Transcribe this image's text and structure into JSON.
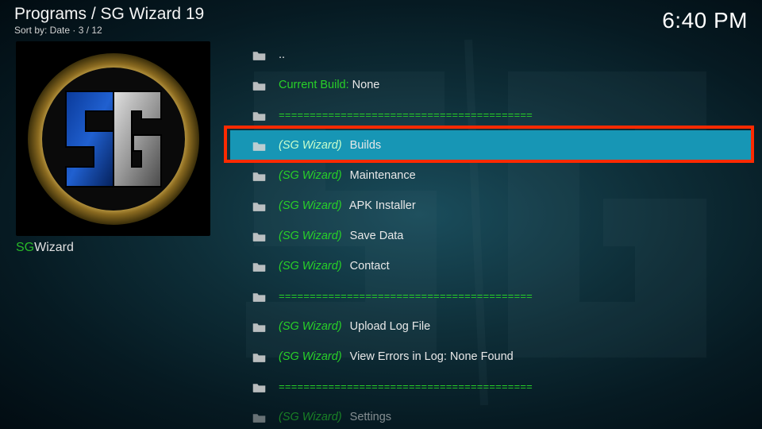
{
  "header": {
    "breadcrumb": "Programs / SG Wizard 19",
    "sortline": "Sort by: Date  ·  3 / 12",
    "clock": "6:40 PM"
  },
  "side": {
    "plugin_sg": "SG",
    "plugin_wizard": "Wizard"
  },
  "list": {
    "items": [
      {
        "type": "updir",
        "label": ".."
      },
      {
        "type": "status",
        "greenLabel": "Current Build:",
        "plain": "  None"
      },
      {
        "type": "separator",
        "sep": "========================================="
      },
      {
        "type": "entry",
        "prefix": "(SG Wizard)",
        "label": "  Builds",
        "selected": true,
        "highlighted": true
      },
      {
        "type": "entry",
        "prefix": "(SG Wizard)",
        "label": "  Maintenance"
      },
      {
        "type": "entry",
        "prefix": "(SG Wizard)",
        "label": "  APK Installer"
      },
      {
        "type": "entry",
        "prefix": "(SG Wizard)",
        "label": "  Save Data"
      },
      {
        "type": "entry",
        "prefix": "(SG Wizard)",
        "label": "  Contact"
      },
      {
        "type": "separator",
        "sep": "========================================="
      },
      {
        "type": "entry",
        "prefix": "(SG Wizard)",
        "label": "  Upload Log File"
      },
      {
        "type": "entry",
        "prefix": "(SG Wizard)",
        "label": "  View Errors in Log: None Found"
      },
      {
        "type": "separator",
        "sep": "========================================="
      },
      {
        "type": "entry-faded",
        "prefix": "(SG Wizard)",
        "label": "  Settings"
      }
    ]
  }
}
